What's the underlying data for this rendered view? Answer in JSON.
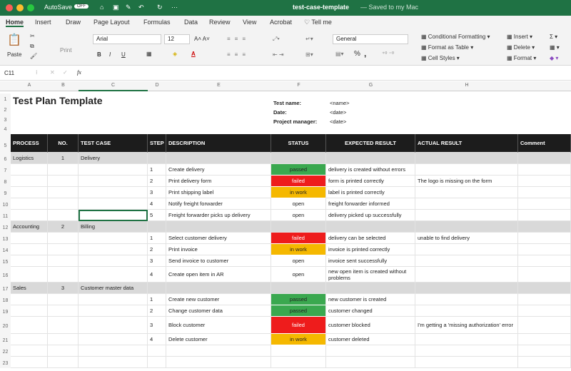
{
  "window": {
    "title": "test-case-template",
    "saved": "— Saved to my Mac",
    "autosave": "AutoSave",
    "autosave_state": "OFF"
  },
  "menu": [
    "Home",
    "Insert",
    "Draw",
    "Page Layout",
    "Formulas",
    "Data",
    "Review",
    "View",
    "Acrobat",
    "Tell me"
  ],
  "ribbon": {
    "paste": "Paste",
    "print": "Print",
    "font": "Arial",
    "size": "12",
    "number_format": "General",
    "conditional": "Conditional Formatting",
    "format_table": "Format as Table",
    "cell_styles": "Cell Styles",
    "insert": "Insert",
    "delete": "Delete",
    "format": "Format",
    "bold": "B",
    "italic": "I",
    "underline": "U",
    "percent": "%",
    "comma": ","
  },
  "formula_bar": {
    "cell_ref": "C11",
    "fx": "fx",
    "value": ""
  },
  "columns": [
    "A",
    "B",
    "C",
    "D",
    "E",
    "F",
    "G",
    "H",
    ""
  ],
  "sheet": {
    "title": "Test Plan Template",
    "meta": [
      {
        "label": "Test name:",
        "value": "<name>"
      },
      {
        "label": "Date:",
        "value": "<date>"
      },
      {
        "label": "Project manager:",
        "value": "<date>"
      }
    ],
    "headers": [
      "PROCESS",
      "NO.",
      "TEST CASE",
      "STEP",
      "DESCRIPTION",
      "STATUS",
      "EXPECTED RESULT",
      "ACTUAL RESULT",
      "Comment"
    ],
    "rows": [
      {
        "type": "group",
        "cells": [
          "Logistics",
          "1",
          "Delivery",
          "",
          "",
          "",
          "",
          "",
          ""
        ]
      },
      {
        "type": "step",
        "cells": [
          "",
          "",
          "",
          "1",
          "Create delivery",
          "passed",
          "delivery is created without errors",
          "",
          ""
        ]
      },
      {
        "type": "step",
        "cells": [
          "",
          "",
          "",
          "2",
          "Print delivery form",
          "failed",
          "form is printed correctly",
          "The logo is missing on the form",
          ""
        ]
      },
      {
        "type": "step",
        "cells": [
          "",
          "",
          "",
          "3",
          "Print shipping label",
          "in work",
          "label is printed correctly",
          "",
          ""
        ]
      },
      {
        "type": "step",
        "cells": [
          "",
          "",
          "",
          "4",
          "Notify freight forwarder",
          "open",
          "freight forwarder informed",
          "",
          ""
        ]
      },
      {
        "type": "step",
        "cells": [
          "",
          "",
          "",
          "5",
          "Freight forwarder picks up delivery",
          "open",
          "delivery picked up successfully",
          "",
          ""
        ]
      },
      {
        "type": "group",
        "cells": [
          "Accounting",
          "2",
          "Billing",
          "",
          "",
          "",
          "",
          "",
          ""
        ]
      },
      {
        "type": "step",
        "cells": [
          "",
          "",
          "",
          "1",
          "Select customer delivery",
          "failed",
          "delivery can be selected",
          "unable to find delivery",
          ""
        ]
      },
      {
        "type": "step",
        "cells": [
          "",
          "",
          "",
          "2",
          "Print invoice",
          "in work",
          "invoice is printed correctly",
          "",
          ""
        ]
      },
      {
        "type": "step",
        "cells": [
          "",
          "",
          "",
          "3",
          "Send invoice to customer",
          "open",
          "invoice sent successfully",
          "",
          ""
        ]
      },
      {
        "type": "step",
        "cells": [
          "",
          "",
          "",
          "4",
          "Create open item in AR",
          "open",
          "new open item is created without problems",
          "",
          ""
        ]
      },
      {
        "type": "group",
        "cells": [
          "Sales",
          "3",
          "Customer master data",
          "",
          "",
          "",
          "",
          "",
          ""
        ]
      },
      {
        "type": "step",
        "cells": [
          "",
          "",
          "",
          "1",
          "Create new customer",
          "passed",
          "new customer is created",
          "",
          ""
        ]
      },
      {
        "type": "step",
        "cells": [
          "",
          "",
          "",
          "2",
          "Change customer data",
          "passed",
          "customer changed",
          "",
          ""
        ]
      },
      {
        "type": "step",
        "cells": [
          "",
          "",
          "",
          "3",
          "Block customer",
          "failed",
          "customer blocked",
          "I'm getting a 'missing authorization' error",
          ""
        ]
      },
      {
        "type": "step",
        "cells": [
          "",
          "",
          "",
          "4",
          "Delete customer",
          "in work",
          "customer deleted",
          "",
          ""
        ]
      },
      {
        "type": "blank",
        "cells": [
          "",
          "",
          "",
          "",
          "",
          "",
          "",
          "",
          ""
        ]
      },
      {
        "type": "blank",
        "cells": [
          "",
          "",
          "",
          "",
          "",
          "",
          "",
          "",
          ""
        ]
      }
    ]
  },
  "status_colors": {
    "passed": "#3aa84f",
    "failed": "#ee1c1c",
    "in work": "#f5b800",
    "open": "#ffffff"
  },
  "accent": "#1f7244"
}
